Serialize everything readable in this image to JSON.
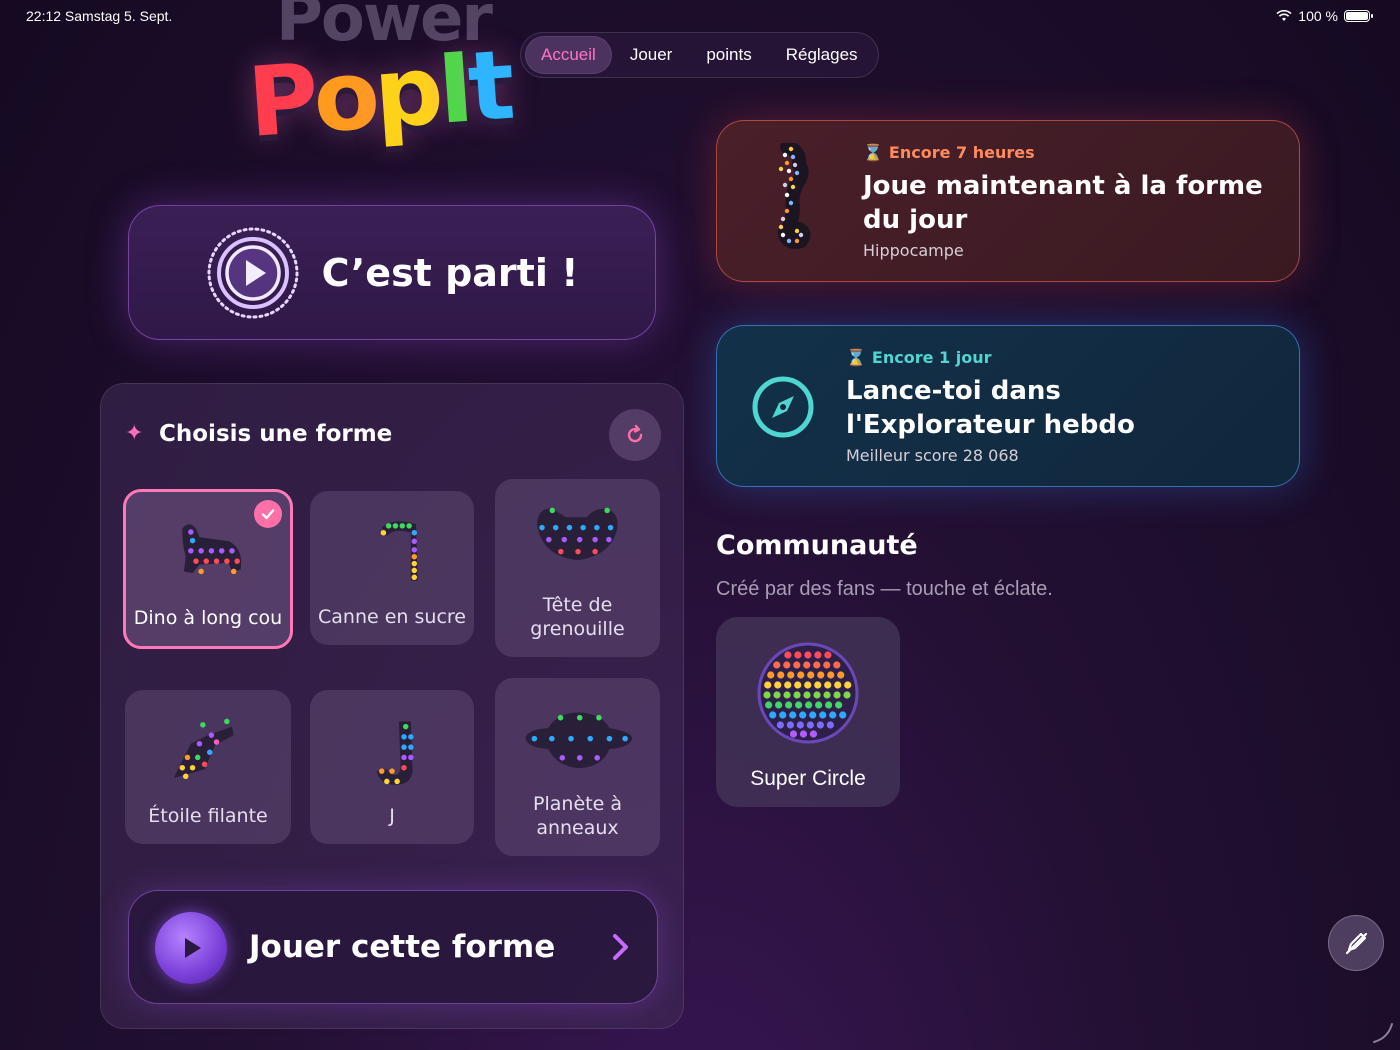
{
  "status_bar": {
    "time_date": "22:12  Samstag 5. Sept.",
    "battery": "100 %",
    "battery_level": 1.0,
    "wifi_icon": "wifi-icon"
  },
  "logo": {
    "line1": "Power",
    "line2": "PopIt"
  },
  "nav": {
    "tabs": [
      {
        "label": "Accueil",
        "active": true
      },
      {
        "label": "Jouer",
        "active": false
      },
      {
        "label": "points",
        "active": false
      },
      {
        "label": "Réglages",
        "active": false
      }
    ]
  },
  "start": {
    "label": "C’est parti !",
    "icon": "play-circle-icon"
  },
  "shape_panel": {
    "title": "Choisis une forme",
    "refresh_icon": "refresh-icon",
    "shapes": [
      {
        "name": "Dino à long cou",
        "selected": true
      },
      {
        "name": "Canne en sucre",
        "selected": false
      },
      {
        "name": "Tête de grenouille",
        "selected": false
      },
      {
        "name": "Étoile filante",
        "selected": false
      },
      {
        "name": "J",
        "selected": false
      },
      {
        "name": "Planète à anneaux",
        "selected": false
      }
    ],
    "play_label": "Jouer cette forme"
  },
  "events": {
    "daily": {
      "timer": "Encore 7 heures",
      "title_line1": "Joue maintenant à la forme",
      "title_line2": "du jour",
      "subtitle": "Hippocampe",
      "accent": "#ff8a5c"
    },
    "weekly": {
      "timer": "Encore 1 jour",
      "title_line1": "Lance-toi dans",
      "title_line2": "l'Explorateur hebdo",
      "subtitle": "Meilleur score 28 068",
      "accent": "#4fd6d0"
    }
  },
  "community": {
    "title": "Communauté",
    "subtitle": "Créé par des fans — touche et éclate.",
    "items": [
      {
        "name": "Super Circle"
      }
    ]
  },
  "colors": {
    "accent_pink": "#ff74c8",
    "accent_purple": "#9a5cf0",
    "background": "#1e0f2e"
  }
}
